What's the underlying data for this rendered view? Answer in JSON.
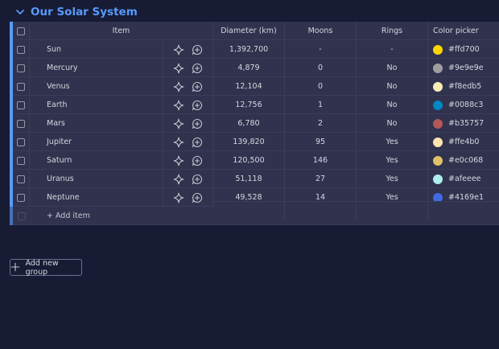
{
  "group": {
    "title": "Our Solar System",
    "accent_color": "#579bfc"
  },
  "columns": {
    "item": "Item",
    "diameter": "Diameter (km)",
    "moons": "Moons",
    "rings": "Rings",
    "color": "Color picker"
  },
  "rows": [
    {
      "name": "Sun",
      "diameter": "1,392,700",
      "moons": "-",
      "rings": "-",
      "color": "#ffd700"
    },
    {
      "name": "Mercury",
      "diameter": "4,879",
      "moons": "0",
      "rings": "No",
      "color": "#9e9e9e"
    },
    {
      "name": "Venus",
      "diameter": "12,104",
      "moons": "0",
      "rings": "No",
      "color": "#f8edb5"
    },
    {
      "name": "Earth",
      "diameter": "12,756",
      "moons": "1",
      "rings": "No",
      "color": "#0088c3"
    },
    {
      "name": "Mars",
      "diameter": "6,780",
      "moons": "2",
      "rings": "No",
      "color": "#b35757"
    },
    {
      "name": "Jupiter",
      "diameter": "139,820",
      "moons": "95",
      "rings": "Yes",
      "color": "#ffe4b0"
    },
    {
      "name": "Saturn",
      "diameter": "120,500",
      "moons": "146",
      "rings": "Yes",
      "color": "#e0c068"
    },
    {
      "name": "Uranus",
      "diameter": "51,118",
      "moons": "27",
      "rings": "Yes",
      "color": "#afeeee"
    },
    {
      "name": "Neptune",
      "diameter": "49,528",
      "moons": "14",
      "rings": "Yes",
      "color": "#4169e1"
    }
  ],
  "add_item_label": "+ Add item",
  "add_group_label": "Add new group",
  "icons": {
    "collapse": "chevron-down-icon",
    "ai": "sparkle-icon",
    "updates": "add-update-icon",
    "add_group": "plus-icon"
  }
}
